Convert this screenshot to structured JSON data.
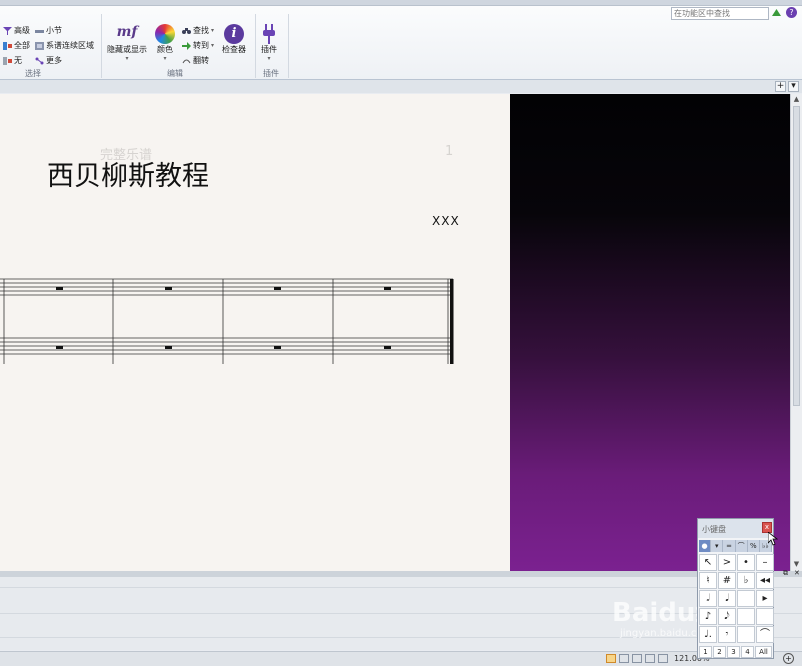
{
  "ribbon": {
    "search_placeholder": "在功能区中查找",
    "select_group": {
      "label": "选择",
      "items": [
        "高级",
        "全部",
        "无",
        "小节",
        "系谱连续区域",
        "更多"
      ]
    },
    "edit_group": {
      "label": "编辑",
      "hide_show": "隐藏或显示",
      "color": "颜色",
      "find": "查找",
      "goto": "转到",
      "flip": "翻转",
      "inspector": "检查器"
    },
    "plugins_group": {
      "label": "插件",
      "plugins": "插件"
    }
  },
  "score": {
    "ghost_header": "完整乐谱",
    "page_number": "1",
    "title": "西贝柳斯教程",
    "composer": "XXX"
  },
  "keypad": {
    "title": "小键盘",
    "close": "x",
    "tabs": [
      "●",
      "▾",
      "═",
      "⌒",
      "%",
      "♭♭"
    ],
    "keys": [
      "↖",
      ">",
      "•",
      "–",
      "♮",
      "#",
      "♭",
      "◂◂",
      "𝅗𝅥",
      "𝅘𝅥",
      "",
      "▸",
      "♪",
      "𝅘𝅥𝅮",
      "",
      "",
      "♩.",
      "𝄾",
      "",
      "⌒"
    ],
    "layout_nums": [
      "1",
      "2",
      "3",
      "4",
      "All"
    ]
  },
  "statusbar": {
    "zoom": "121.00%"
  },
  "watermark": {
    "main": "Baidu经验",
    "sub": "jingyan.baidu.com"
  }
}
